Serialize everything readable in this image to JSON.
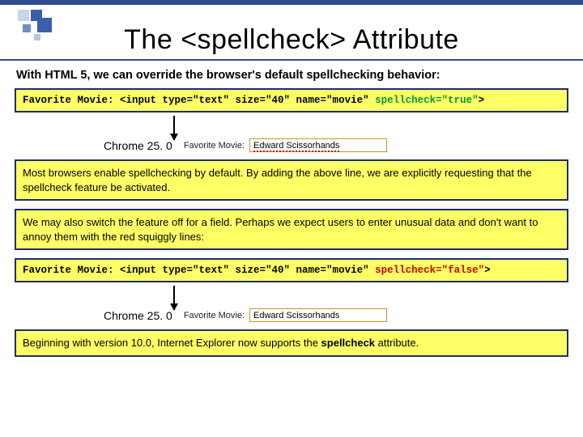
{
  "title": "The <spellcheck> Attribute",
  "intro": "With HTML 5, we can override the browser's default spellchecking behavior:",
  "code1": {
    "pre": "Favorite Movie: <input type=\"text\" size=\"40\" name=\"movie\" ",
    "attr": "spellcheck=\"true\"",
    "post": ">"
  },
  "chromeLabel": "Chrome 25. 0",
  "demoLabel": "Favorite Movie:",
  "demoValue": "Edward Scissorhands",
  "box1": "Most browsers enable spellchecking by default.  By adding the above line, we are explicitly requesting that the spellcheck feature be activated.",
  "box2": "We may also switch the feature off for a field.  Perhaps we expect users to enter unusual data and don't want to annoy them with the red squiggly lines:",
  "code2": {
    "pre": "Favorite Movie: <input type=\"text\" size=\"40\" name=\"movie\" ",
    "attr": "spellcheck=\"false\"",
    "post": ">"
  },
  "box3a": "Beginning with version 10.0, Internet Explorer now supports the ",
  "box3b": "spellcheck",
  "box3c": " attribute."
}
